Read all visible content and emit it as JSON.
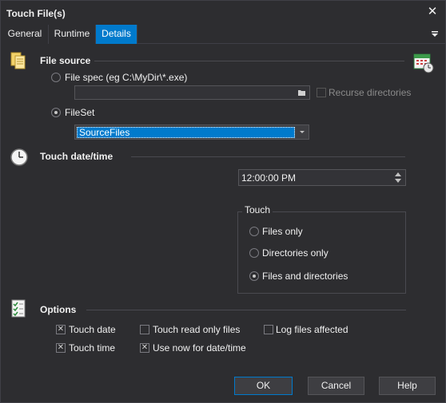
{
  "window": {
    "title": "Touch File(s)"
  },
  "tabs": [
    {
      "label": "General"
    },
    {
      "label": "Runtime"
    },
    {
      "label": "Details"
    }
  ],
  "file_source": {
    "heading": "File source",
    "filespec_label": "File spec (eg C:\\MyDir\\*.exe)",
    "filespec_value": "",
    "recurse_label": "Recurse directories",
    "fileset_label": "FileSet",
    "fileset_value": "SourceFiles"
  },
  "touch_datetime": {
    "heading": "Touch date/time",
    "time_value": "12:00:00 PM"
  },
  "touch_group": {
    "title": "Touch",
    "options": [
      "Files only",
      "Directories only",
      "Files and directories"
    ],
    "selected": "Files and directories"
  },
  "options": {
    "heading": "Options",
    "touch_date": "Touch date",
    "touch_time": "Touch time",
    "touch_read_only": "Touch read only files",
    "use_now": "Use now for date/time",
    "log_files": "Log files affected"
  },
  "buttons": {
    "ok": "OK",
    "cancel": "Cancel",
    "help": "Help"
  }
}
